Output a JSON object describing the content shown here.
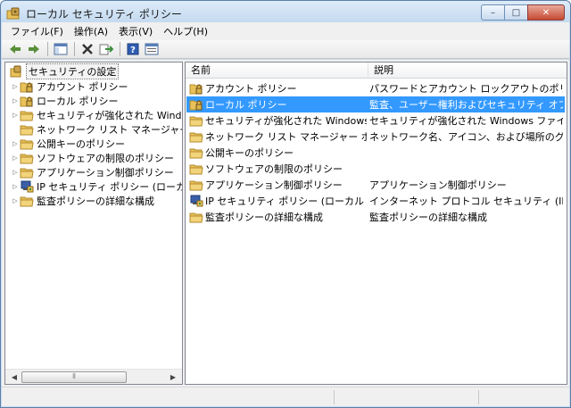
{
  "window": {
    "title": "ローカル セキュリティ ポリシー"
  },
  "caption": {
    "minimize": "–",
    "maximize": "□",
    "close": "✕"
  },
  "menu": [
    "ファイル(F)",
    "操作(A)",
    "表示(V)",
    "ヘルプ(H)"
  ],
  "toolbar": [
    "back-icon",
    "forward-icon",
    "show-hide-tree-icon",
    "delete-icon",
    "export-list-icon",
    "help-icon",
    "properties-icon"
  ],
  "tree": {
    "root": "セキュリティの設定",
    "items": [
      {
        "label": "アカウント ポリシー",
        "icon": "folder-lock-icon",
        "expandable": true
      },
      {
        "label": "ローカル ポリシー",
        "icon": "folder-lock-icon",
        "expandable": true
      },
      {
        "label": "セキュリティが強化された Windows",
        "icon": "folder-icon",
        "expandable": true
      },
      {
        "label": "ネットワーク リスト マネージャー ポ",
        "icon": "folder-icon",
        "expandable": false
      },
      {
        "label": "公開キーのポリシー",
        "icon": "folder-icon",
        "expandable": true
      },
      {
        "label": "ソフトウェアの制限のポリシー",
        "icon": "folder-icon",
        "expandable": true
      },
      {
        "label": "アプリケーション制御ポリシー",
        "icon": "folder-icon",
        "expandable": true
      },
      {
        "label": "IP セキュリティ ポリシー (ローカル",
        "icon": "ip-security-icon",
        "expandable": true
      },
      {
        "label": "監査ポリシーの詳細な構成",
        "icon": "folder-icon",
        "expandable": true
      }
    ]
  },
  "list": {
    "columns": [
      "名前",
      "説明"
    ],
    "rows": [
      {
        "name": "アカウント ポリシー",
        "desc": "パスワードとアカウント ロックアウトのポリ...",
        "icon": "folder-lock-icon",
        "selected": false
      },
      {
        "name": "ローカル ポリシー",
        "desc": "監査、ユーザー権利およびセキュリティ オプ...",
        "icon": "folder-lock-icon",
        "selected": true
      },
      {
        "name": "セキュリティが強化された Windows ...",
        "desc": "セキュリティが強化された Windows ファイ...",
        "icon": "folder-icon",
        "selected": false
      },
      {
        "name": "ネットワーク リスト マネージャー ポ...",
        "desc": "ネットワーク名、アイコン、および場所のグ...",
        "icon": "folder-icon",
        "selected": false
      },
      {
        "name": "公開キーのポリシー",
        "desc": "",
        "icon": "folder-icon",
        "selected": false
      },
      {
        "name": "ソフトウェアの制限のポリシー",
        "desc": "",
        "icon": "folder-icon",
        "selected": false
      },
      {
        "name": "アプリケーション制御ポリシー",
        "desc": "アプリケーション制御ポリシー",
        "icon": "folder-icon",
        "selected": false
      },
      {
        "name": "IP セキュリティ ポリシー (ローカル コ...",
        "desc": "インターネット プロトコル セキュリティ (IP...",
        "icon": "ip-security-icon",
        "selected": false
      },
      {
        "name": "監査ポリシーの詳細な構成",
        "desc": "監査ポリシーの詳細な構成",
        "icon": "folder-icon",
        "selected": false
      }
    ]
  },
  "colors": {
    "selection": "#3399ff",
    "folder": "#e8c158"
  }
}
